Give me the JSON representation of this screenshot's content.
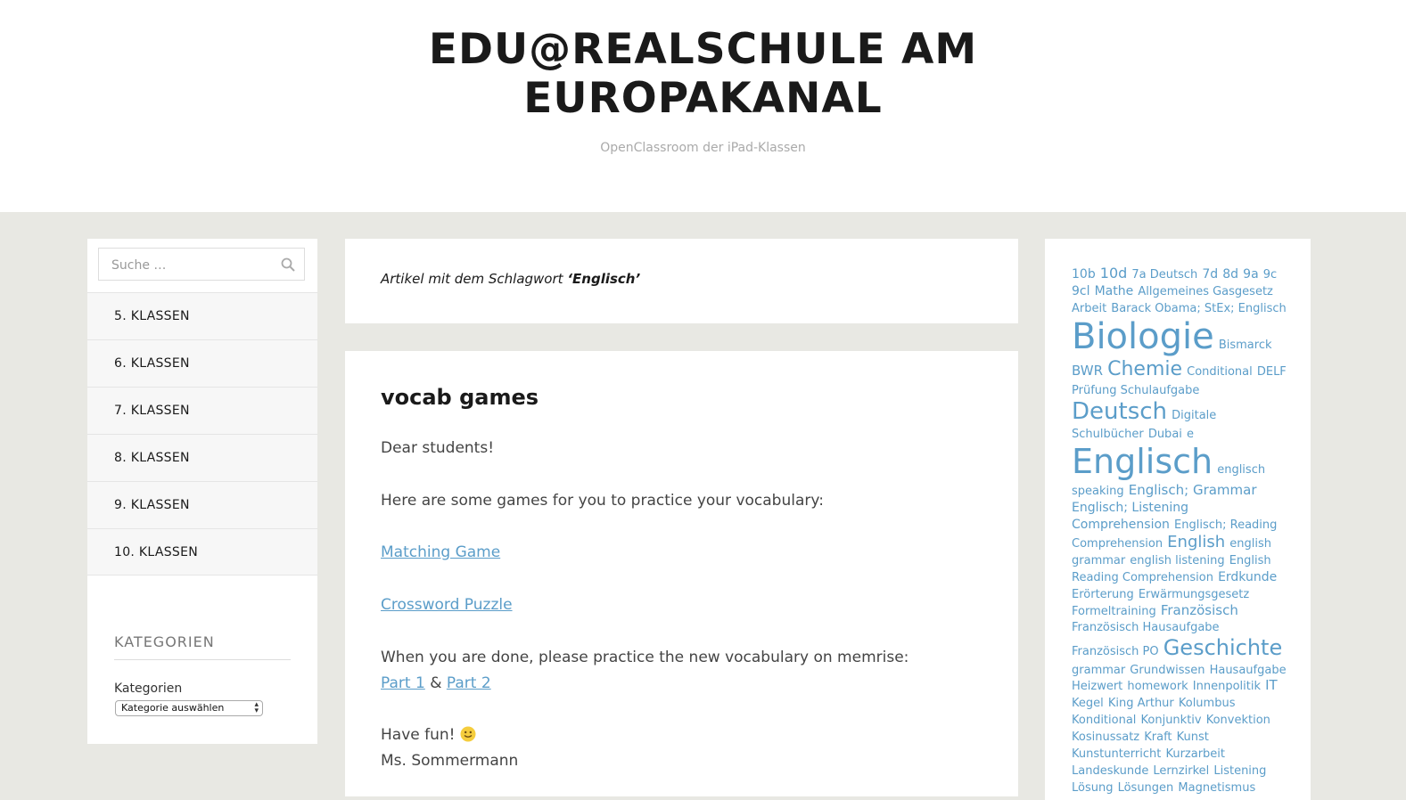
{
  "header": {
    "title_line1": "EDU@REALSCHULE AM",
    "title_line2": "EUROPAKANAL",
    "description": "OpenClassroom der iPad-Klassen"
  },
  "search": {
    "placeholder": "Suche …",
    "icon": "search-icon"
  },
  "menu": [
    {
      "label": "5. KLASSEN"
    },
    {
      "label": "6. KLASSEN"
    },
    {
      "label": "7. KLASSEN"
    },
    {
      "label": "8. KLASSEN"
    },
    {
      "label": "9. KLASSEN"
    },
    {
      "label": "10. KLASSEN"
    }
  ],
  "categories": {
    "widget_title": "KATEGORIEN",
    "label": "Kategorien",
    "selected": "Kategorie auswählen"
  },
  "archive": {
    "prefix": "Artikel mit dem Schlagwort",
    "tag": "‘Englisch’"
  },
  "post": {
    "title": "vocab games",
    "greeting": "Dear students!",
    "intro": "Here are some games for you to practice your vocabulary:",
    "link1": "Matching Game",
    "link2": "Crossword Puzzle",
    "done_text": "When you are done, please practice the new vocabulary on memrise:",
    "part1": "Part 1",
    "amp": "&",
    "part2": "Part 2",
    "fun": "Have fun!",
    "signature": "Ms. Sommermann"
  },
  "colors": {
    "link": "#5b9dc9",
    "background": "#e8e8e3"
  },
  "tags": [
    {
      "t": "10b",
      "s": 14
    },
    {
      "t": "10d",
      "s": 16
    },
    {
      "t": "7a Deutsch",
      "s": 13
    },
    {
      "t": "7d",
      "s": 14
    },
    {
      "t": "8d",
      "s": 14
    },
    {
      "t": "9a",
      "s": 14
    },
    {
      "t": "9c",
      "s": 13
    },
    {
      "t": "9cl",
      "s": 14
    },
    {
      "t": "Mathe",
      "s": 14
    },
    {
      "t": "Allgemeines Gasgesetz",
      "s": 13
    },
    {
      "t": "Arbeit",
      "s": 13
    },
    {
      "t": "Barack Obama; StEx; Englisch",
      "s": 13
    },
    {
      "t": "Biologie",
      "s": 40
    },
    {
      "t": "Bismarck",
      "s": 13
    },
    {
      "t": "BWR",
      "s": 15
    },
    {
      "t": "Chemie",
      "s": 22
    },
    {
      "t": "Conditional",
      "s": 13
    },
    {
      "t": "DELF Prüfung Schulaufgabe",
      "s": 13
    },
    {
      "t": "Deutsch",
      "s": 26
    },
    {
      "t": "Digitale Schulbücher",
      "s": 13
    },
    {
      "t": "Dubai",
      "s": 13
    },
    {
      "t": "e",
      "s": 13
    },
    {
      "t": "Englisch",
      "s": 38
    },
    {
      "t": "englisch speaking",
      "s": 13
    },
    {
      "t": "Englisch; Grammar",
      "s": 15
    },
    {
      "t": "Englisch; Listening Comprehension",
      "s": 14
    },
    {
      "t": "Englisch; Reading Comprehension",
      "s": 13
    },
    {
      "t": "English",
      "s": 18
    },
    {
      "t": "english grammar",
      "s": 13
    },
    {
      "t": "english listening",
      "s": 13
    },
    {
      "t": "English Reading Comprehension",
      "s": 13
    },
    {
      "t": "Erdkunde",
      "s": 14
    },
    {
      "t": "Erörterung",
      "s": 13
    },
    {
      "t": "Erwärmungsgesetz",
      "s": 13
    },
    {
      "t": "Formeltraining",
      "s": 13
    },
    {
      "t": "Französisch",
      "s": 15
    },
    {
      "t": "Französisch Hausaufgabe",
      "s": 13
    },
    {
      "t": "Französisch PO",
      "s": 13
    },
    {
      "t": "Geschichte",
      "s": 24
    },
    {
      "t": "grammar",
      "s": 13
    },
    {
      "t": "Grundwissen",
      "s": 13
    },
    {
      "t": "Hausaufgabe",
      "s": 13
    },
    {
      "t": "Heizwert",
      "s": 13
    },
    {
      "t": "homework",
      "s": 13
    },
    {
      "t": "Innenpolitik",
      "s": 13
    },
    {
      "t": "IT",
      "s": 15
    },
    {
      "t": "Kegel",
      "s": 13
    },
    {
      "t": "King Arthur",
      "s": 13
    },
    {
      "t": "Kolumbus",
      "s": 13
    },
    {
      "t": "Konditional",
      "s": 13
    },
    {
      "t": "Konjunktiv",
      "s": 13
    },
    {
      "t": "Konvektion",
      "s": 13
    },
    {
      "t": "Kosinussatz",
      "s": 13
    },
    {
      "t": "Kraft",
      "s": 13
    },
    {
      "t": "Kunst",
      "s": 13
    },
    {
      "t": "Kunstunterricht",
      "s": 13
    },
    {
      "t": "Kurzarbeit",
      "s": 13
    },
    {
      "t": "Landeskunde",
      "s": 13
    },
    {
      "t": "Lernzirkel",
      "s": 13
    },
    {
      "t": "Listening",
      "s": 13
    },
    {
      "t": "Lösung",
      "s": 13
    },
    {
      "t": "Lösungen",
      "s": 13
    },
    {
      "t": "Magnetismus",
      "s": 13
    }
  ]
}
